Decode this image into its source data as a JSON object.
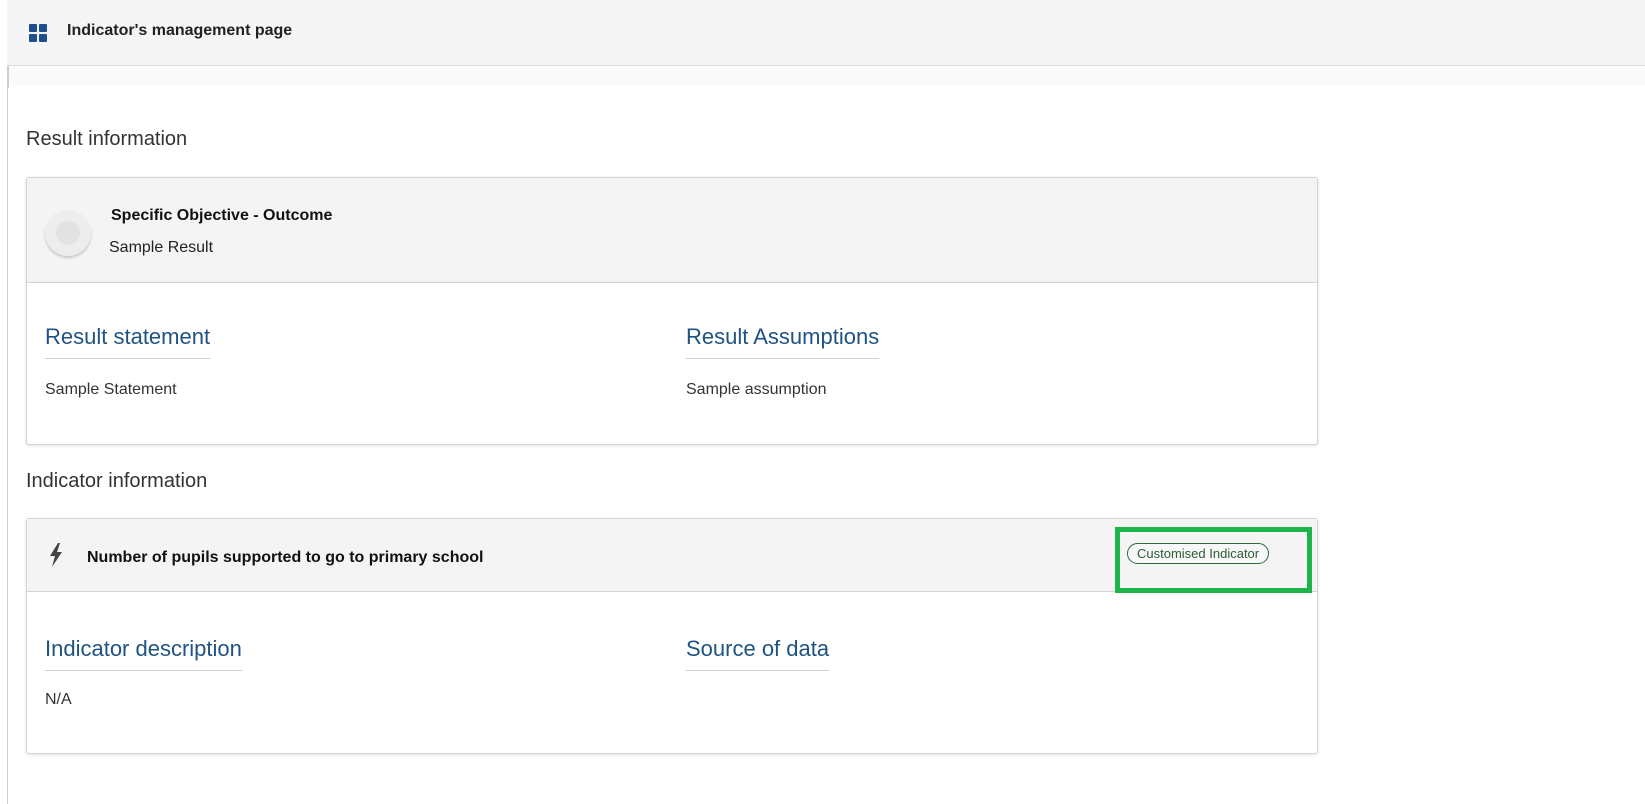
{
  "header": {
    "title": "Indicator's management page",
    "icon": "grid-icon",
    "accent_color": "#1f4e8c"
  },
  "result_section": {
    "title": "Result information",
    "card": {
      "heading": "Specific Objective - Outcome",
      "subheading": "Sample Result",
      "columns": [
        {
          "label": "Result statement",
          "value": "Sample Statement"
        },
        {
          "label": "Result Assumptions",
          "value": "Sample assumption"
        }
      ]
    }
  },
  "indicator_section": {
    "title": "Indicator information",
    "card": {
      "icon": "bolt-icon",
      "heading": "Number of pupils supported to go to primary school",
      "badge": "Customised Indicator",
      "badge_highlight_color": "#1db44a",
      "columns": [
        {
          "label": "Indicator description",
          "value": "N/A"
        },
        {
          "label": "Source of data",
          "value": ""
        }
      ]
    }
  },
  "colors": {
    "link_blue": "#1f5383",
    "panel_gray": "#f4f4f4"
  }
}
